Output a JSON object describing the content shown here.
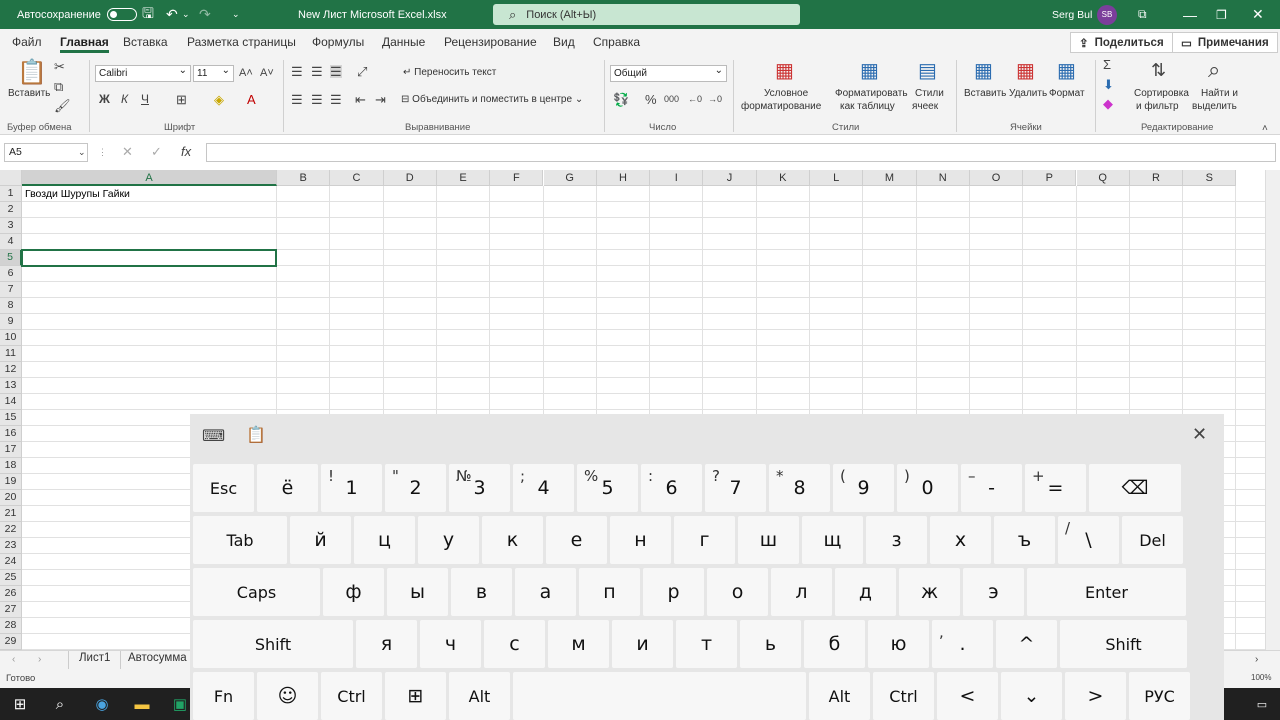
{
  "titlebar": {
    "autosave_label": "Автосохранение",
    "doc_title": "New Лист Microsoft Excel.xlsx",
    "search_placeholder": "Поиск (Alt+Ы)",
    "user_name": "Serg Bul",
    "user_initials": "SB"
  },
  "tabs": [
    "Файл",
    "Главная",
    "Вставка",
    "Разметка страницы",
    "Формулы",
    "Данные",
    "Рецензирование",
    "Вид",
    "Справка"
  ],
  "share_label": "Поделиться",
  "comments_label": "Примечания",
  "ribbon": {
    "paste_label": "Вставить",
    "clipboard_group": "Буфер обмена",
    "font_name": "Calibri",
    "font_size": "11",
    "font_group": "Шрифт",
    "wrap_text": "Переносить текст",
    "merge_center": "Объединить и поместить в центре",
    "align_group": "Выравнивание",
    "number_format": "Общий",
    "number_group": "Число",
    "cond_format_1": "Условное",
    "cond_format_2": "форматирование",
    "format_table_1": "Форматировать",
    "format_table_2": "как таблицу",
    "cell_styles_1": "Стили",
    "cell_styles_2": "ячеек",
    "styles_group": "Стили",
    "insert_label": "Вставить",
    "delete_label": "Удалить",
    "format_label": "Формат",
    "cells_group": "Ячейки",
    "sort_1": "Сортировка",
    "sort_2": "и фильтр",
    "find_1": "Найти и",
    "find_2": "выделить",
    "edit_group": "Редактирование",
    "bold": "Ж",
    "italic": "К",
    "underline": "Ч"
  },
  "namebox": "A5",
  "columns": [
    "A",
    "B",
    "C",
    "D",
    "E",
    "F",
    "G",
    "H",
    "I",
    "J",
    "K",
    "L",
    "M",
    "N",
    "O",
    "P",
    "Q",
    "R",
    "S"
  ],
  "rows": [
    "1",
    "2",
    "3",
    "4",
    "5",
    "6",
    "7",
    "8",
    "9",
    "10",
    "11",
    "12",
    "13",
    "14",
    "15",
    "16",
    "17",
    "18",
    "19",
    "20",
    "21",
    "22",
    "23",
    "24",
    "25",
    "26",
    "27",
    "28",
    "29"
  ],
  "cell_a1": "Гвозди Шурупы Гайки",
  "sheets": [
    "Лист1",
    "Автосумма"
  ],
  "status": {
    "ready": "Готово",
    "zoom": "100%"
  },
  "keyboard": {
    "row1": [
      {
        "k": "Esc"
      },
      {
        "k": "ё"
      },
      {
        "k": "1",
        "a": "!"
      },
      {
        "k": "2",
        "a": "\""
      },
      {
        "k": "3",
        "a": "№"
      },
      {
        "k": "4",
        "a": ";"
      },
      {
        "k": "5",
        "a": "%"
      },
      {
        "k": "6",
        "a": ":"
      },
      {
        "k": "7",
        "a": "?"
      },
      {
        "k": "8",
        "a": "*"
      },
      {
        "k": "9",
        "a": "("
      },
      {
        "k": "0",
        "a": ")"
      },
      {
        "k": "-",
        "a": "–"
      },
      {
        "k": "=",
        "a": "+"
      },
      {
        "k": "⌫"
      }
    ],
    "row2": [
      {
        "k": "Tab"
      },
      {
        "k": "й"
      },
      {
        "k": "ц"
      },
      {
        "k": "у"
      },
      {
        "k": "к"
      },
      {
        "k": "е"
      },
      {
        "k": "н"
      },
      {
        "k": "г"
      },
      {
        "k": "ш"
      },
      {
        "k": "щ"
      },
      {
        "k": "з"
      },
      {
        "k": "х"
      },
      {
        "k": "ъ"
      },
      {
        "k": "\\",
        "a": "/"
      },
      {
        "k": "Del"
      }
    ],
    "row3": [
      {
        "k": "Caps"
      },
      {
        "k": "ф"
      },
      {
        "k": "ы"
      },
      {
        "k": "в"
      },
      {
        "k": "а"
      },
      {
        "k": "п"
      },
      {
        "k": "р"
      },
      {
        "k": "о"
      },
      {
        "k": "л"
      },
      {
        "k": "д"
      },
      {
        "k": "ж"
      },
      {
        "k": "э"
      },
      {
        "k": "Enter"
      }
    ],
    "row4": [
      {
        "k": "Shift"
      },
      {
        "k": "я"
      },
      {
        "k": "ч"
      },
      {
        "k": "с"
      },
      {
        "k": "м"
      },
      {
        "k": "и"
      },
      {
        "k": "т"
      },
      {
        "k": "ь"
      },
      {
        "k": "б"
      },
      {
        "k": "ю"
      },
      {
        "k": ".",
        "a": ","
      },
      {
        "k": "^"
      },
      {
        "k": "Shift"
      }
    ],
    "row5": [
      {
        "k": "Fn"
      },
      {
        "k": "☺"
      },
      {
        "k": "Ctrl"
      },
      {
        "k": "⊞"
      },
      {
        "k": "Alt"
      },
      {
        "k": ""
      },
      {
        "k": "Alt"
      },
      {
        "k": "Ctrl"
      },
      {
        "k": "<"
      },
      {
        "k": "⌄"
      },
      {
        "k": ">"
      },
      {
        "k": "РУС"
      }
    ]
  },
  "colors": {
    "excel_green": "#217346"
  }
}
